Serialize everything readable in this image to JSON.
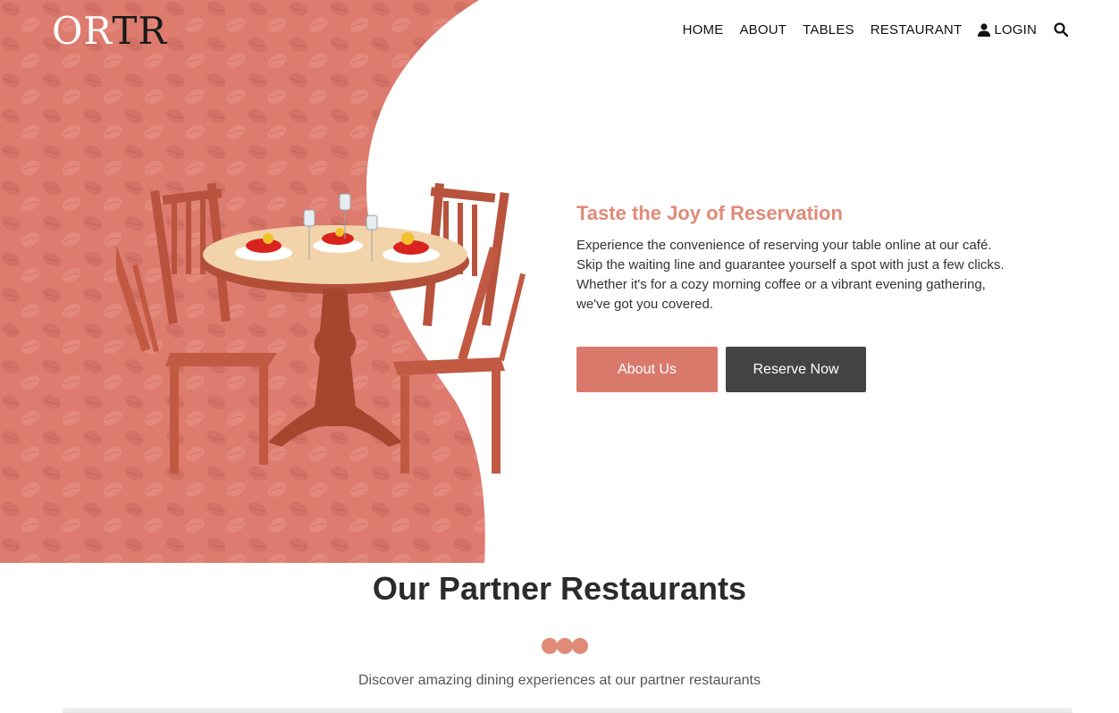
{
  "brand": {
    "logo_light": "OR",
    "logo_dark": "TR"
  },
  "nav": {
    "items": [
      {
        "label": "HOME"
      },
      {
        "label": "ABOUT"
      },
      {
        "label": "TABLES"
      },
      {
        "label": "RESTAURANT"
      }
    ],
    "login_label": "LOGIN",
    "icons": {
      "user": "user-icon",
      "search": "search-icon"
    }
  },
  "hero": {
    "title": "Taste the Joy of Reservation",
    "body": "Experience the convenience of reserving your table online at our café. Skip the waiting line and guarantee yourself a spot with just a few clicks. Whether it's for a cozy morning coffee or a vibrant evening gathering, we've got you covered.",
    "about_button": "About Us",
    "reserve_button": "Reserve Now"
  },
  "partners": {
    "title": "Our Partner Restaurants",
    "subtitle": "Discover amazing dining experiences at our partner restaurants"
  },
  "colors": {
    "accent": "#e08a78",
    "button_primary": "#d9796c",
    "button_dark": "#444444",
    "hero_bg": "#dc7b6e"
  }
}
